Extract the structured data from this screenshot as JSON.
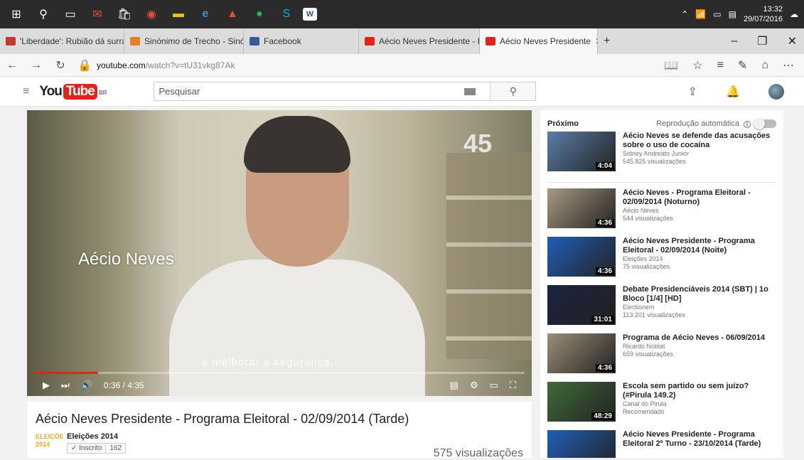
{
  "taskbar": {
    "apps": [
      "start-icon",
      "search-icon",
      "task-view-icon",
      "mail-icon",
      "store-icon",
      "vivaldi-icon",
      "file-explorer-icon",
      "edge-icon",
      "acrobat-icon",
      "spotify-icon",
      "skype-icon",
      "word-icon"
    ],
    "time": "13:32",
    "date": "29/07/2016"
  },
  "browser": {
    "tabs": [
      {
        "label": "'Liberdade': Rubião dá surra",
        "favicon_color": "#c0392b"
      },
      {
        "label": "Sinónimo de Trecho - Sinón",
        "favicon_color": "#e67e22"
      },
      {
        "label": "Facebook",
        "favicon_color": "#3b5998"
      },
      {
        "label": "Aécio Neves Presidente - Pr",
        "favicon_color": "#e62117"
      },
      {
        "label": "Aécio Neves Presidente",
        "favicon_color": "#e62117",
        "active": true
      }
    ],
    "url_domain": "youtube.com",
    "url_path": "/watch?v=tU31vkg87Ak"
  },
  "youtube": {
    "logo_you": "You",
    "logo_tube": "Tube",
    "logo_country": "BR",
    "search_placeholder": "Pesquisar"
  },
  "player": {
    "overlay_number": "45",
    "overlay_name": "Aécio Neves",
    "caption": "e melhorar a segurança.",
    "time": "0:36 / 4:35",
    "progress": 0.13
  },
  "video": {
    "title": "Aécio Neves Presidente - Programa Eleitoral - 02/09/2014 (Tarde)",
    "channel_thumb_text": "ELEIÇÕE 2014",
    "channel": "Eleições 2014",
    "subscribe_label": "✓ Inscrito",
    "subscriber_count": "162",
    "views": "575 visualizações"
  },
  "sidebar": {
    "next_label": "Próximo",
    "autoplay_label": "Reprodução automática",
    "items": [
      {
        "title": "Aécio Neves se defende das acusações sobre o uso de cocaína",
        "channel": "Sidney Andreato Junior",
        "views": "545.825 visualizações",
        "duration": "4:04",
        "thumb_color": "#5a7da8"
      },
      {
        "title": "Aécio Neves - Programa Eleitoral - 02/09/2014 (Noturno)",
        "channel": "Aécio Neves",
        "views": "544 visualizações",
        "duration": "4:36",
        "thumb_color": "#a89a80"
      },
      {
        "title": "Aécio Neves Presidente - Programa Eleitoral - 02/09/2014 (Noite)",
        "channel": "Eleições 2014",
        "views": "75 visualizações",
        "duration": "4:36",
        "thumb_color": "#1f5fb8"
      },
      {
        "title": "Debate Presidenciáveis 2014 (SBT) | 1o Bloco [1/4] [HD]",
        "channel": "Electionem",
        "views": "113.201 visualizações",
        "duration": "31:01",
        "thumb_color": "#1c2340"
      },
      {
        "title": "Programa de Aécio Neves - 06/09/2014",
        "channel": "Ricardo Noblat",
        "views": "659 visualizações",
        "duration": "4:36",
        "thumb_color": "#9c8f78"
      },
      {
        "title": "Escola sem partido ou sem juízo? (#Pirula 149.2)",
        "channel": "Canal do Pirula",
        "views": "Recomendado",
        "duration": "48:29",
        "thumb_color": "#3e6b3a"
      },
      {
        "title": "Aécio Neves Presidente - Programa Eleitoral 2º Turno - 23/10/2014 (Tarde)",
        "channel": "",
        "views": "",
        "duration": "",
        "thumb_color": "#1f5fb8"
      }
    ]
  }
}
